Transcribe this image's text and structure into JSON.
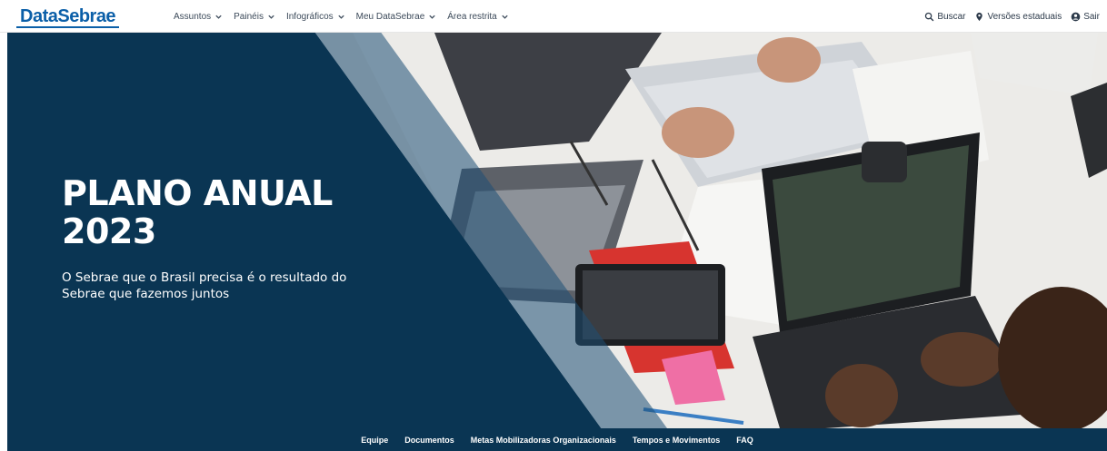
{
  "header": {
    "logo": "DataSebrae",
    "menu": [
      {
        "label": "Assuntos",
        "icon": "chevron-down-icon"
      },
      {
        "label": "Painéis",
        "icon": "chevron-down-icon"
      },
      {
        "label": "Infográficos",
        "icon": "chevron-down-icon"
      },
      {
        "label": "Meu DataSebrae",
        "icon": "chevron-down-icon"
      },
      {
        "label": "Área restrita",
        "icon": "chevron-down-icon"
      }
    ],
    "tools": [
      {
        "label": "Buscar",
        "icon": "search-icon"
      },
      {
        "label": "Versões estaduais",
        "icon": "map-pin-icon"
      },
      {
        "label": "Sair",
        "icon": "user-icon"
      }
    ]
  },
  "hero": {
    "title_line1": "PLANO ANUAL",
    "title_line2": "2023",
    "subtitle": "O Sebrae que o Brasil precisa é o resultado do Sebrae que fazemos juntos",
    "image": "people-working-with-laptops-photo"
  },
  "footer": {
    "links": [
      "Equipe",
      "Documentos",
      "Metas Mobilizadoras Organizacionais",
      "Tempos e Movimentos",
      "FAQ"
    ]
  },
  "colors": {
    "brand_blue": "#0b5fa8",
    "hero_navy": "#0a3553",
    "footer_navy": "#0a3553"
  }
}
